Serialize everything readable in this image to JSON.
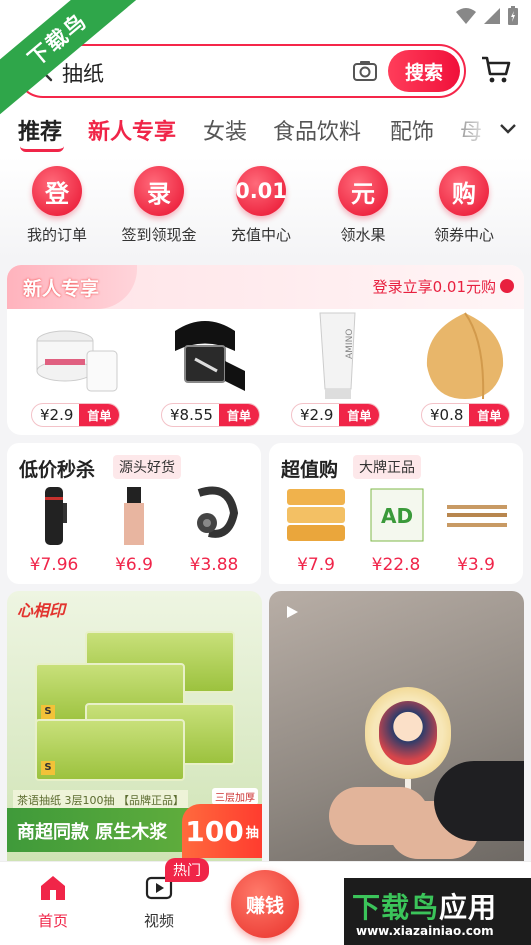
{
  "status": {
    "icons": [
      "wifi-icon",
      "signal-icon",
      "battery-icon"
    ]
  },
  "ribbon": {
    "text": "下载鸟"
  },
  "search": {
    "query": "抽纸",
    "button": "搜索"
  },
  "categories": [
    {
      "label": "推荐"
    },
    {
      "label": "新人专享"
    },
    {
      "label": "女装"
    },
    {
      "label": "食品饮料"
    },
    {
      "label": "配饰"
    },
    {
      "label": "母"
    }
  ],
  "quick": [
    {
      "icon_text": "登",
      "label": "我的订单"
    },
    {
      "icon_text": "录",
      "label": "签到领现金"
    },
    {
      "icon_text": "0.01",
      "label": "充值中心"
    },
    {
      "icon_text": "元",
      "label": "领水果"
    },
    {
      "icon_text": "购",
      "label": "领券中心"
    }
  ],
  "newuser": {
    "title": "新人专享",
    "promo": "登录立享0.01元购",
    "badge": "首单",
    "items": [
      {
        "price": "¥2.9",
        "image": "compressed-towel-image"
      },
      {
        "price": "¥8.55",
        "image": "belt-image"
      },
      {
        "price": "¥2.9",
        "image": "cleanser-tube-image"
      },
      {
        "price": "¥0.8",
        "image": "cosmetic-puff-image"
      }
    ]
  },
  "flash": {
    "title": "低价秒杀",
    "sub": "源头好货",
    "items": [
      {
        "price": "¥7.96"
      },
      {
        "price": "¥6.9"
      },
      {
        "price": "¥3.88"
      }
    ]
  },
  "super": {
    "title": "超值购",
    "sub": "大牌正品",
    "items": [
      {
        "price": "¥7.9"
      },
      {
        "price": "¥22.8"
      },
      {
        "price": "¥3.9"
      }
    ]
  },
  "feed_left": {
    "brand": "心相印",
    "tag": "茶语抽纸 3层100抽 【品牌正品】",
    "tag2": "三层加厚",
    "slogan": "商超同款 原生木浆",
    "count": "100",
    "count_unit": "抽",
    "box_s": "S"
  },
  "bottom_nav": {
    "home": "首页",
    "video": "视频",
    "hot": "热门",
    "earn": "赚钱"
  },
  "watermark": {
    "title_a": "下载鸟",
    "title_b": "应用",
    "url": "www.xiazainiao.com"
  },
  "colors": {
    "accent": "#f02548",
    "green": "#2fa64a"
  }
}
